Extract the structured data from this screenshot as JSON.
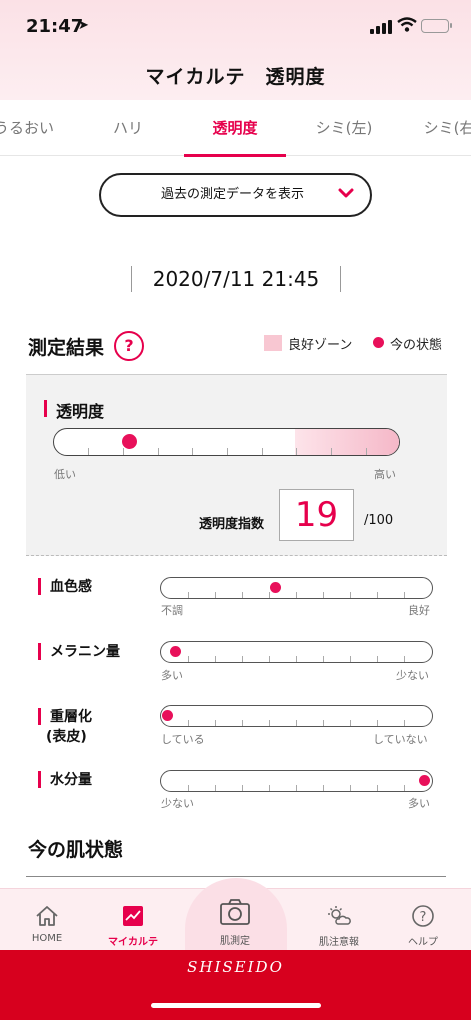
{
  "status": {
    "time": "21:47",
    "location_arrow": "➤"
  },
  "header": {
    "title": "マイカルテ　透明度"
  },
  "tabs": [
    {
      "label": "うるおい"
    },
    {
      "label": "ハリ"
    },
    {
      "label": "透明度"
    },
    {
      "label": "シミ(左)"
    },
    {
      "label": "シミ(右)"
    }
  ],
  "past_data_button": {
    "label": "過去の測定データを表示"
  },
  "measurement": {
    "datetime": "2020/7/11 21:45"
  },
  "results": {
    "title": "測定結果",
    "help_symbol": "?",
    "legend": {
      "good_zone": "良好ゾーン",
      "current_state": "今の状態"
    }
  },
  "main_metric": {
    "label": "透明度",
    "low_label": "低い",
    "high_label": "高い",
    "index_label": "透明度指数",
    "index_value": "19",
    "index_max": "/100",
    "level": 0.19,
    "good_zone_start": 0.7
  },
  "sub_metrics": [
    {
      "label": "血色感",
      "left_label": "不調",
      "right_label": "良好",
      "level": 0.42
    },
    {
      "label": "メラニン量",
      "left_label": "多い",
      "right_label": "少ない",
      "level": 0.03
    },
    {
      "label": "重層化",
      "label2": "(表皮)",
      "left_label": "している",
      "right_label": "していない",
      "level": 0.0
    },
    {
      "label": "水分量",
      "left_label": "少ない",
      "right_label": "多い",
      "level": 1.0
    }
  ],
  "current_skin": {
    "title": "今の肌状態"
  },
  "nav": [
    {
      "label": "HOME",
      "icon": "home-icon"
    },
    {
      "label": "マイカルテ",
      "icon": "chart-icon"
    },
    {
      "label": "肌測定",
      "icon": "camera-icon"
    },
    {
      "label": "肌注意報",
      "icon": "sun-cloud-icon"
    },
    {
      "label": "ヘルプ",
      "icon": "help-icon"
    }
  ],
  "brand": {
    "name": "SHISEIDO"
  },
  "colors": {
    "accent": "#e6004c",
    "brand_red": "#d7001e",
    "zone": "#f8c7d2"
  }
}
